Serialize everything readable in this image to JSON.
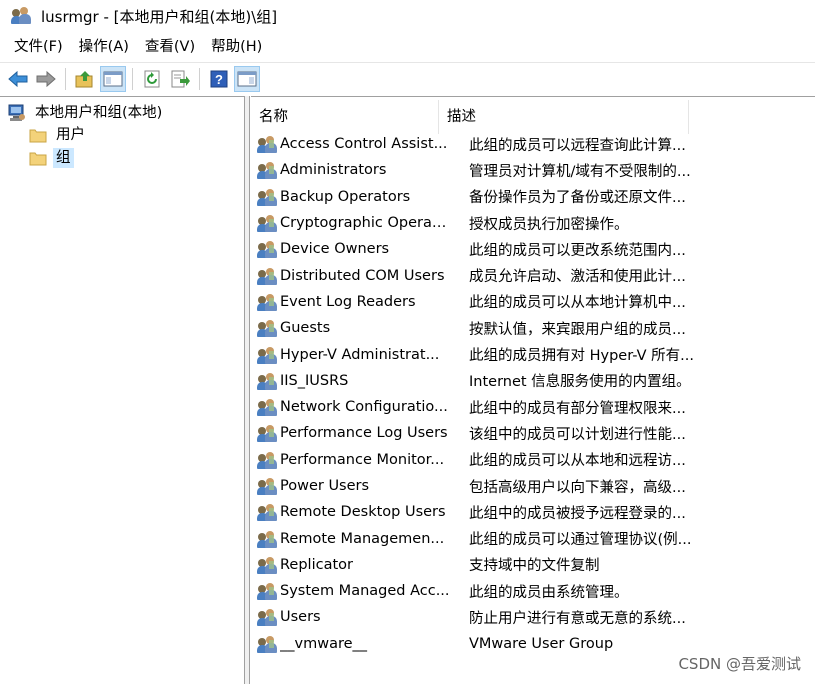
{
  "window": {
    "title": "lusrmgr - [本地用户和组(本地)\\组]"
  },
  "menu": [
    "文件(F)",
    "操作(A)",
    "查看(V)",
    "帮助(H)"
  ],
  "toolbar": {
    "buttons": [
      "back-arrow-icon",
      "forward-arrow-icon",
      "up-folder-icon",
      "show-hide-tree-icon",
      "refresh-icon",
      "export-list-icon",
      "help-icon",
      "properties-pane-icon"
    ]
  },
  "tree": {
    "root": "本地用户和组(本地)",
    "children": [
      "用户",
      "组"
    ],
    "selected": "组"
  },
  "list": {
    "columns": [
      "名称",
      "描述"
    ],
    "rows": [
      {
        "name": "Access Control Assist...",
        "desc": "此组的成员可以远程查询此计算..."
      },
      {
        "name": "Administrators",
        "desc": "管理员对计算机/域有不受限制的..."
      },
      {
        "name": "Backup Operators",
        "desc": "备份操作员为了备份或还原文件..."
      },
      {
        "name": "Cryptographic Operat...",
        "desc": "授权成员执行加密操作。"
      },
      {
        "name": "Device Owners",
        "desc": "此组的成员可以更改系统范围内..."
      },
      {
        "name": "Distributed COM Users",
        "desc": "成员允许启动、激活和使用此计..."
      },
      {
        "name": "Event Log Readers",
        "desc": "此组的成员可以从本地计算机中..."
      },
      {
        "name": "Guests",
        "desc": "按默认值，来宾跟用户组的成员..."
      },
      {
        "name": "Hyper-V Administrat...",
        "desc": "此组的成员拥有对 Hyper-V 所有..."
      },
      {
        "name": "IIS_IUSRS",
        "desc": "Internet 信息服务使用的内置组。"
      },
      {
        "name": "Network Configuratio...",
        "desc": "此组中的成员有部分管理权限来..."
      },
      {
        "name": "Performance Log Users",
        "desc": "该组中的成员可以计划进行性能..."
      },
      {
        "name": "Performance Monitor...",
        "desc": "此组的成员可以从本地和远程访..."
      },
      {
        "name": "Power Users",
        "desc": "包括高级用户以向下兼容，高级..."
      },
      {
        "name": "Remote Desktop Users",
        "desc": "此组中的成员被授予远程登录的..."
      },
      {
        "name": "Remote Managemen...",
        "desc": "此组的成员可以通过管理协议(例..."
      },
      {
        "name": "Replicator",
        "desc": "支持域中的文件复制"
      },
      {
        "name": "System Managed Acc...",
        "desc": "此组的成员由系统管理。"
      },
      {
        "name": "Users",
        "desc": "防止用户进行有意或无意的系统..."
      },
      {
        "name": "__vmware__",
        "desc": "VMware User Group"
      }
    ]
  },
  "watermark": "CSDN @吾爱测试",
  "colors": {
    "selection": "#cce8ff",
    "toolbar_active": "#cce4f7",
    "border": "#a0a0a0"
  }
}
